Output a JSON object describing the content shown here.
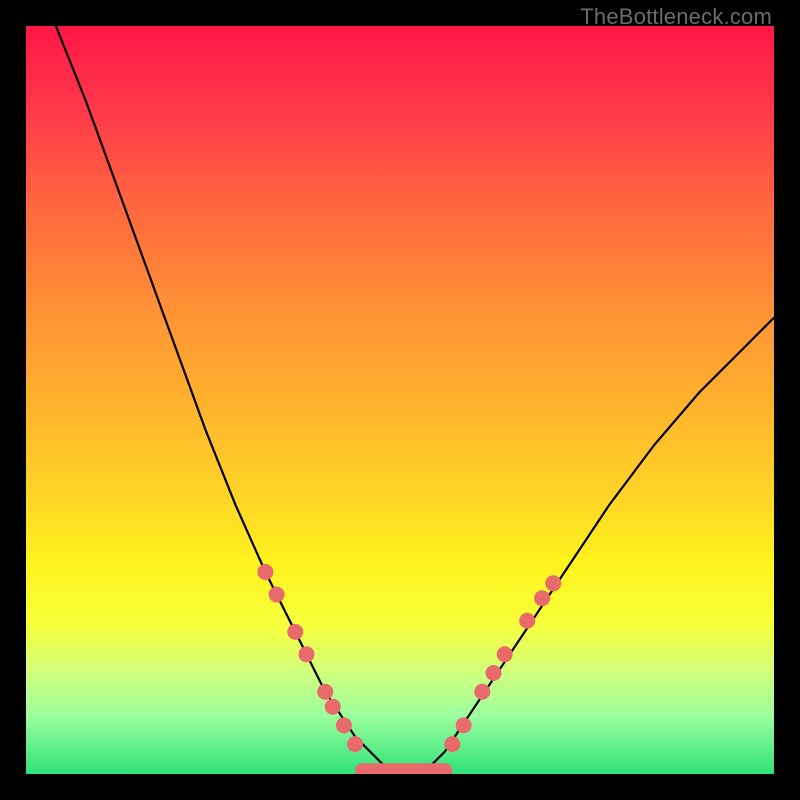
{
  "watermark": "TheBottleneck.com",
  "chart_data": {
    "type": "line",
    "title": "",
    "xlabel": "",
    "ylabel": "",
    "xlim": [
      0,
      100
    ],
    "ylim": [
      0,
      100
    ],
    "grid": false,
    "legend": false,
    "series": [
      {
        "name": "bottleneck-curve",
        "x": [
          4,
          8,
          12,
          16,
          20,
          24,
          28,
          32,
          36,
          40,
          42,
          44,
          46,
          48,
          50,
          52,
          54,
          56,
          58,
          62,
          66,
          70,
          74,
          78,
          84,
          90,
          96,
          100
        ],
        "y": [
          100,
          90,
          79,
          68,
          57,
          46,
          36,
          27,
          19,
          11,
          8,
          5,
          3,
          1,
          0.5,
          0.5,
          1,
          3,
          6,
          12,
          18,
          24,
          30,
          36,
          44,
          51,
          57,
          61
        ]
      }
    ],
    "markers": {
      "name": "highlight-dots",
      "color": "#e86a6a",
      "points": [
        {
          "x": 32,
          "y": 27
        },
        {
          "x": 33.5,
          "y": 24
        },
        {
          "x": 36,
          "y": 19
        },
        {
          "x": 37.5,
          "y": 16
        },
        {
          "x": 40,
          "y": 11
        },
        {
          "x": 41,
          "y": 9
        },
        {
          "x": 42.5,
          "y": 6.5
        },
        {
          "x": 44,
          "y": 4
        },
        {
          "x": 57,
          "y": 4
        },
        {
          "x": 58.5,
          "y": 6.5
        },
        {
          "x": 61,
          "y": 11
        },
        {
          "x": 62.5,
          "y": 13.5
        },
        {
          "x": 64,
          "y": 16
        },
        {
          "x": 67,
          "y": 20.5
        },
        {
          "x": 69,
          "y": 23.5
        },
        {
          "x": 70.5,
          "y": 25.5
        }
      ]
    },
    "flat_segment": {
      "name": "bottom-bar",
      "color": "#e86a6a",
      "x_start": 44,
      "x_end": 57,
      "y": 0.5
    }
  }
}
